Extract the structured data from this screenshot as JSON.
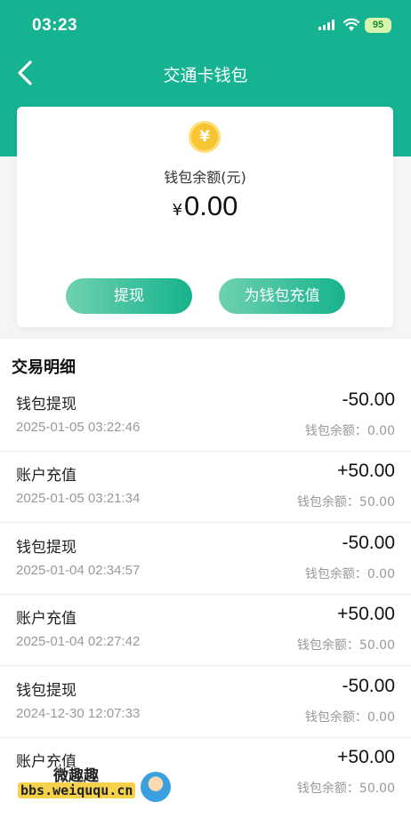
{
  "status_bar": {
    "time": "03:23",
    "battery": "95"
  },
  "nav": {
    "title": "交通卡钱包"
  },
  "wallet": {
    "coin_symbol": "¥",
    "balance_label": "钱包余额(元)",
    "currency": "¥",
    "balance": "0.00",
    "withdraw_label": "提现",
    "recharge_label": "为钱包充值"
  },
  "transactions": {
    "title": "交易明细",
    "items": [
      {
        "type": "钱包提现",
        "amount": "-50.00",
        "date": "2025-01-05 03:22:46",
        "balance": "钱包余额：0.00"
      },
      {
        "type": "账户充值",
        "amount": "+50.00",
        "date": "2025-01-05 03:21:34",
        "balance": "钱包余额：50.00"
      },
      {
        "type": "钱包提现",
        "amount": "-50.00",
        "date": "2025-01-04 02:34:57",
        "balance": "钱包余额：0.00"
      },
      {
        "type": "账户充值",
        "amount": "+50.00",
        "date": "2025-01-04 02:27:42",
        "balance": "钱包余额：50.00"
      },
      {
        "type": "钱包提现",
        "amount": "-50.00",
        "date": "2024-12-30 12:07:33",
        "balance": "钱包余额：0.00"
      },
      {
        "type": "账户充值",
        "amount": "+50.00",
        "date": "",
        "balance": "钱包余额：50.00"
      }
    ]
  },
  "watermark": {
    "text_cn": "微趣趣",
    "url": "bbs.weiququ.cn"
  },
  "colors": {
    "brand": "#15b391",
    "button_gradient_start": "#6fd1b0",
    "coin": "#f7c531"
  }
}
